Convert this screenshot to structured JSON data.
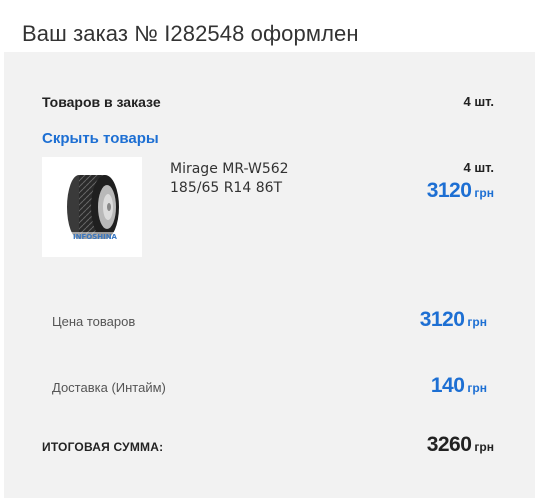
{
  "page": {
    "title": "Ваш заказ № I282548 оформлен"
  },
  "order": {
    "items_heading": "Товаров в заказе",
    "items_count": "4 шт.",
    "toggle_label": "Скрыть товары",
    "product": {
      "name_line1": "Mirage MR-W562",
      "name_line2": "185/65 R14 86T",
      "qty": "4 шт.",
      "price": "3120",
      "currency": "грн",
      "image_watermark": "INFOSHINA",
      "image_icon": "tire-icon"
    },
    "summary": {
      "goods_label": "Цена товаров",
      "goods_price": "3120",
      "delivery_label": "Доставка (Интайм)",
      "delivery_price": "140",
      "total_label": "ИТОГОВАЯ СУММА:",
      "total_price": "3260",
      "currency": "грн"
    }
  },
  "colors": {
    "accent": "#1d6fd3",
    "panel": "#f2f2f2",
    "text": "#222222"
  }
}
